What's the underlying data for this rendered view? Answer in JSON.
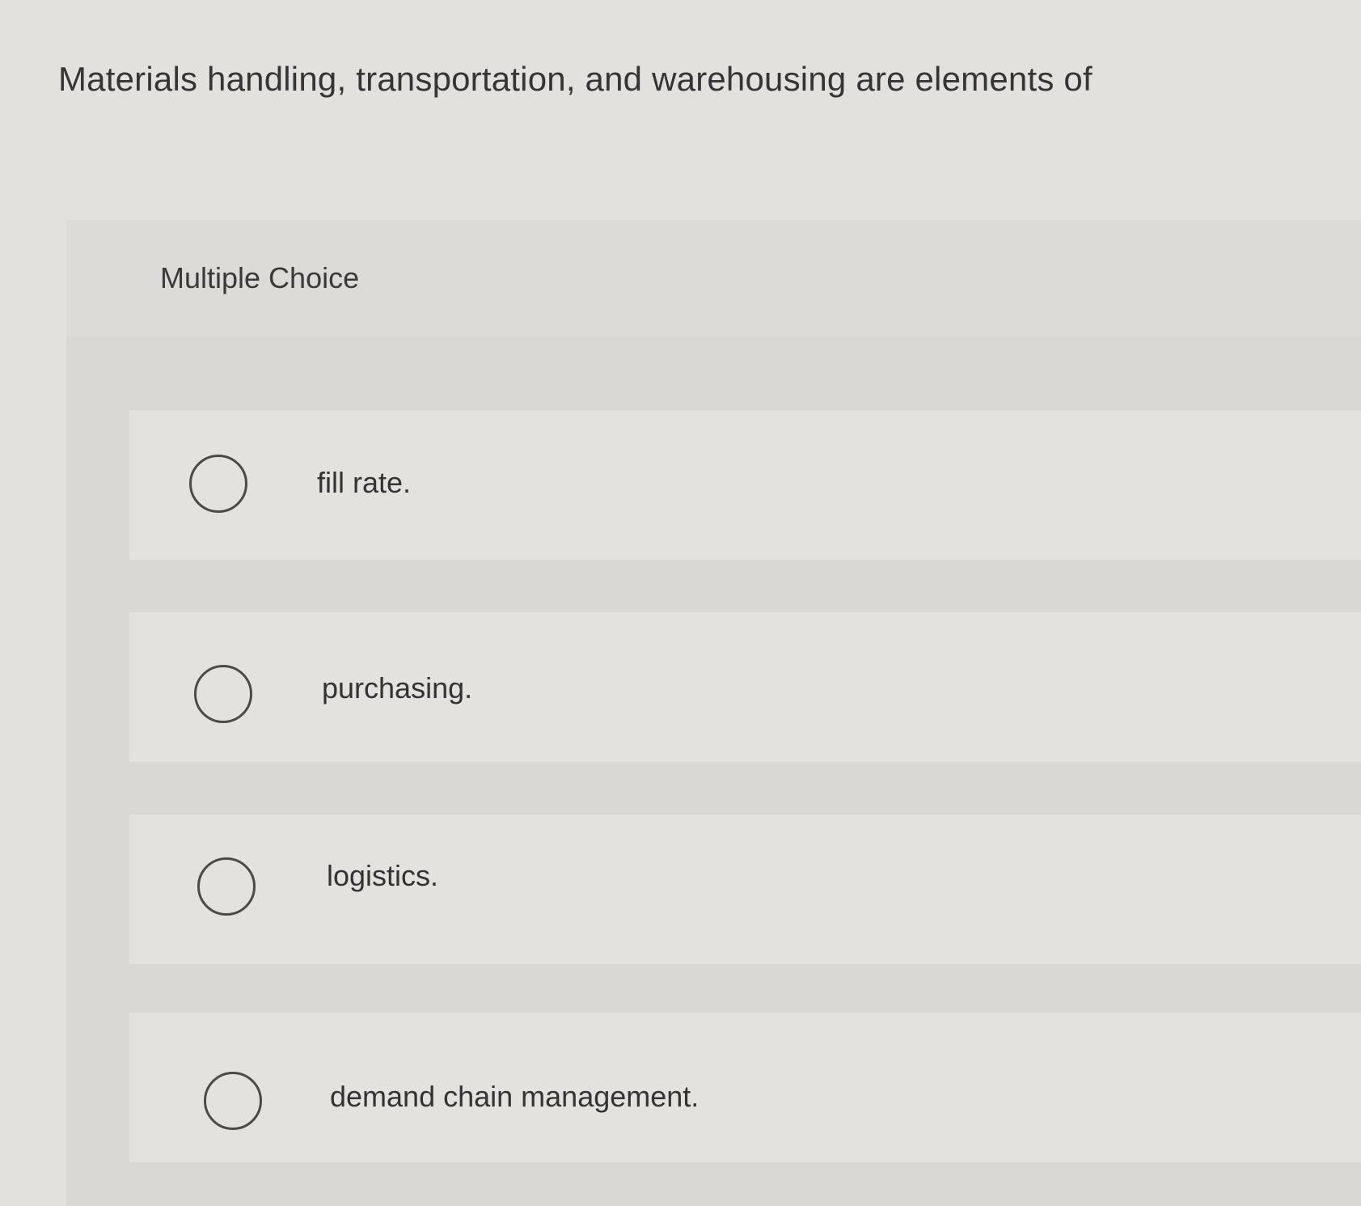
{
  "question": {
    "text": "Materials handling, transportation, and warehousing are elements of"
  },
  "multiple_choice": {
    "label": "Multiple Choice",
    "options": [
      {
        "label": "fill rate.",
        "selected": false
      },
      {
        "label": "purchasing.",
        "selected": false
      },
      {
        "label": "logistics.",
        "selected": false
      },
      {
        "label": "demand chain management.",
        "selected": false
      }
    ]
  },
  "colors": {
    "background": "#e3e1de",
    "panel": "#d9d8d5",
    "text": "#353535",
    "radio_border": "#4a4a4a"
  }
}
